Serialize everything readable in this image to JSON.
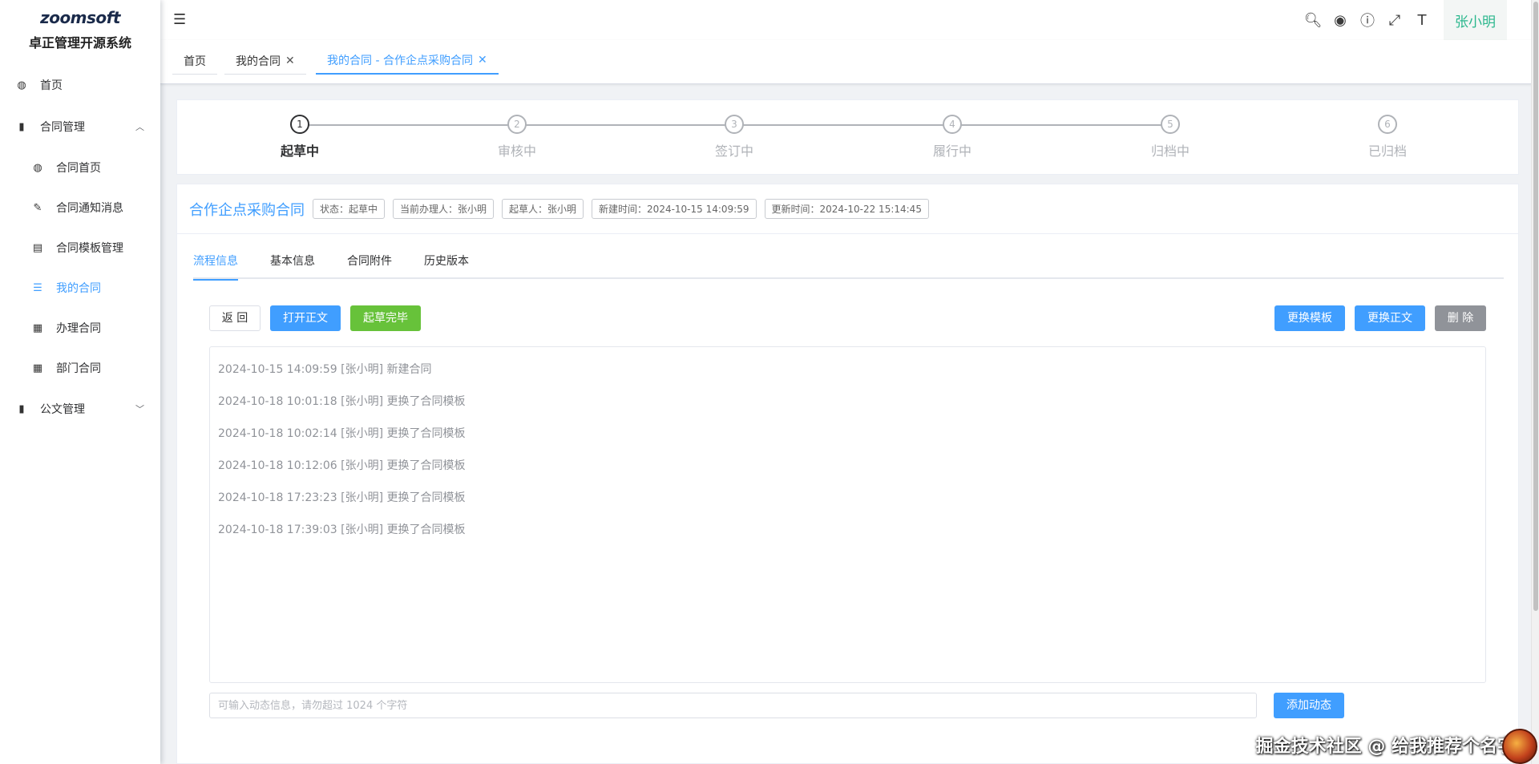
{
  "logo": {
    "mark": "zoomsoft",
    "title": "卓正管理开源系统"
  },
  "sidebar": {
    "items": [
      {
        "label": "首页",
        "icon": "dashboard-icon"
      },
      {
        "label": "合同管理",
        "icon": "book-icon",
        "expanded": true
      },
      {
        "label": "合同首页",
        "icon": "dashboard-icon"
      },
      {
        "label": "合同通知消息",
        "icon": "edit-icon"
      },
      {
        "label": "合同模板管理",
        "icon": "template-icon"
      },
      {
        "label": "我的合同",
        "icon": "list-icon",
        "active": true
      },
      {
        "label": "办理合同",
        "icon": "document-icon"
      },
      {
        "label": "部门合同",
        "icon": "document-icon"
      },
      {
        "label": "公文管理",
        "icon": "book-icon",
        "expanded": false
      }
    ]
  },
  "header": {
    "user": "张小明",
    "icons": [
      "search-icon",
      "github-icon",
      "help-icon",
      "fullscreen-icon",
      "font-size-icon"
    ]
  },
  "tags": [
    {
      "label": "首页"
    },
    {
      "label": "我的合同",
      "closable": true
    },
    {
      "label": "我的合同 - 合作企点采购合同",
      "closable": true,
      "active": true
    }
  ],
  "steps": [
    {
      "num": "1",
      "label": "起草中",
      "current": true
    },
    {
      "num": "2",
      "label": "审核中"
    },
    {
      "num": "3",
      "label": "签订中"
    },
    {
      "num": "4",
      "label": "履行中"
    },
    {
      "num": "5",
      "label": "归档中"
    },
    {
      "num": "6",
      "label": "已归档"
    }
  ],
  "contract": {
    "title": "合作企点采购合同",
    "badges": [
      "状态：起草中",
      "当前办理人：张小明",
      "起草人：张小明",
      "新建时间：2024-10-15 14:09:59",
      "更新时间：2024-10-22 15:14:45"
    ]
  },
  "tabs": [
    "流程信息",
    "基本信息",
    "合同附件",
    "历史版本"
  ],
  "buttons": {
    "back": "返 回",
    "open": "打开正文",
    "finish": "起草完毕",
    "change_template": "更换模板",
    "change_text": "更换正文",
    "delete": "删 除",
    "add": "添加动态"
  },
  "logs": [
    "2024-10-15 14:09:59 [张小明] 新建合同",
    "2024-10-18 10:01:18 [张小明] 更换了合同模板",
    "2024-10-18 10:02:14 [张小明] 更换了合同模板",
    "2024-10-18 10:12:06 [张小明] 更换了合同模板",
    "2024-10-18 17:23:23 [张小明] 更换了合同模板",
    "2024-10-18 17:39:03 [张小明] 更换了合同模板"
  ],
  "comment": {
    "placeholder": "可输入动态信息，请勿超过 1024 个字符",
    "value": ""
  },
  "watermark": "掘金技术社区 @ 给我推荐个名字",
  "colors": {
    "primary": "#409eff",
    "success": "#67c23a",
    "gray": "#909399",
    "user": "#2ab78d"
  }
}
